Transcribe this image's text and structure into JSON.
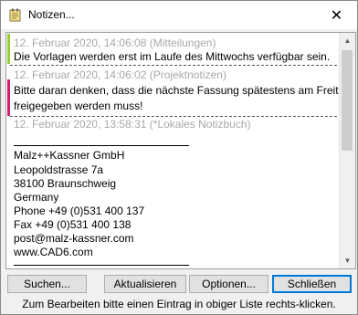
{
  "window": {
    "title": "Notizen...",
    "app_icon": "notepad-icon",
    "close_icon": "close-icon",
    "close_glyph": "✕"
  },
  "entries": [
    {
      "meta": "12. Februar 2020, 14:06:08 (Mitteilungen)",
      "lines": [
        "Die Vorlagen werden erst im Laufe des Mittwochs verfügbar sein."
      ],
      "color": "#9acd32"
    },
    {
      "meta": "12. Februar 2020, 14:06:02 (Projektnotizen)",
      "lines": [
        "Bitte daran denken, dass die nächste Fassung spätestens am Freitag",
        "freigegeben werden muss!"
      ],
      "color": "#d02070"
    },
    {
      "meta": "12. Februar 2020, 13:58:31 (*Lokales Notizbuch)",
      "lines": []
    }
  ],
  "card": {
    "lines": [
      "Malz++Kassner GmbH",
      "Leopoldstrasse 7a",
      "38100 Braunschweig",
      "Germany",
      "Phone +49 (0)531 400 137",
      "Fax +49 (0)531 400 138",
      "post@malz-kassner.com",
      "www.CAD6.com"
    ]
  },
  "scrollbar": {
    "up_icon": "scroll-up-arrow-icon",
    "down_icon": "scroll-down-arrow-icon",
    "up_glyph": "▲",
    "down_glyph": "▼"
  },
  "buttons": {
    "search": "Suchen...",
    "refresh": "Aktualisieren",
    "options": "Optionen...",
    "close": "Schließen"
  },
  "hint": "Zum Bearbeiten bitte einen Eintrag in obiger Liste rechts-klicken."
}
